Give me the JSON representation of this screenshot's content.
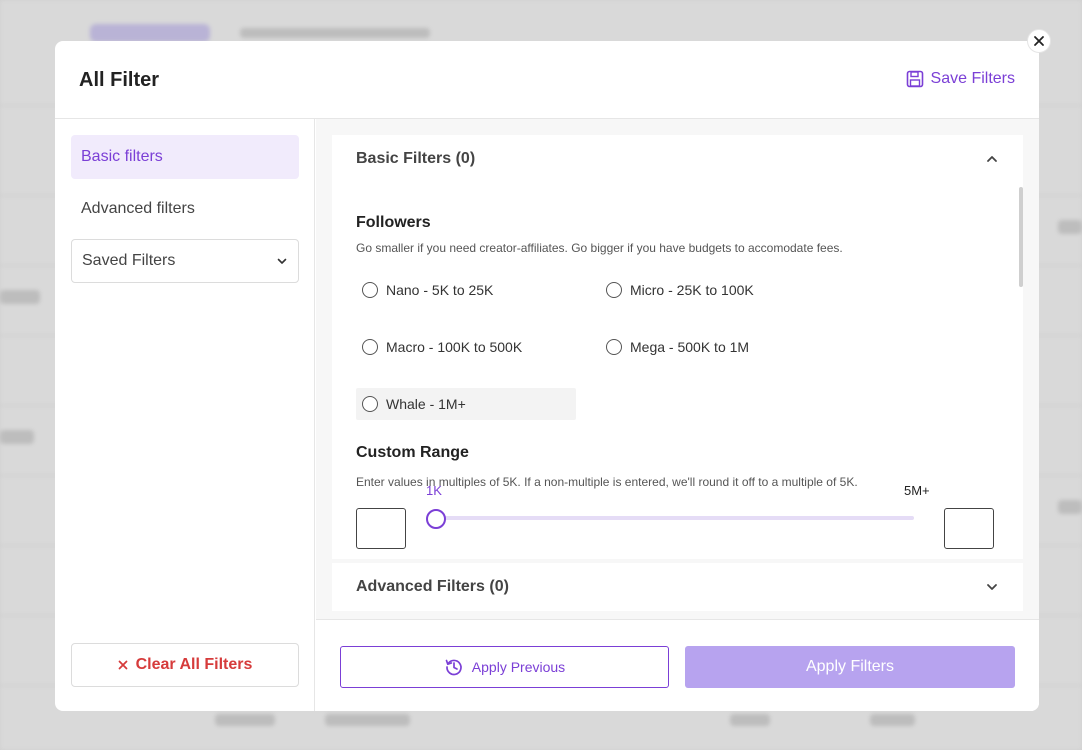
{
  "modal": {
    "title": "All Filter",
    "save_label": "Save Filters"
  },
  "sidebar": {
    "items": [
      {
        "label": "Basic filters",
        "active": true
      },
      {
        "label": "Advanced filters",
        "active": false
      }
    ],
    "saved_select": "Saved Filters",
    "clear_label": "Clear All Filters"
  },
  "sections": {
    "basic": {
      "label": "Basic Filters (0)",
      "expanded": true
    },
    "advanced": {
      "label": "Advanced Filters (0)",
      "expanded": false
    }
  },
  "followers": {
    "heading": "Followers",
    "hint": "Go smaller if you need creator-affiliates. Go bigger if you have budgets to accomodate fees.",
    "options": [
      "Nano - 5K to 25K",
      "Micro - 25K to 100K",
      "Macro - 100K to 500K",
      "Mega - 500K to 1M",
      "Whale - 1M+"
    ]
  },
  "custom_range": {
    "heading": "Custom Range",
    "hint": "Enter values in multiples of 5K. If a non-multiple is entered, we'll round it off to a multiple of 5K.",
    "min_label": "1K",
    "max_label": "5M+",
    "min_value": "",
    "max_value": ""
  },
  "footer": {
    "apply_previous": "Apply Previous",
    "apply_filters": "Apply Filters"
  },
  "colors": {
    "accent": "#7b3fd6",
    "danger": "#d63b3b",
    "apply_disabled": "#b7a3ef"
  }
}
